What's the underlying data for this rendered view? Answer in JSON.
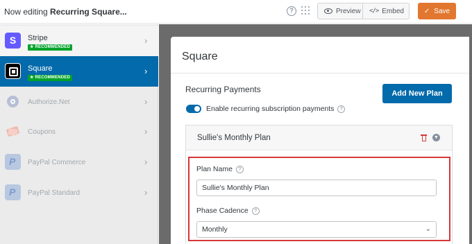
{
  "header": {
    "title_prefix": "Now editing ",
    "title_form": "Recurring Square...",
    "help_glyph": "?",
    "preview_label": "Preview",
    "embed_label": "Embed",
    "save_label": "Save"
  },
  "sidebar": {
    "items": [
      {
        "label": "Stripe",
        "badge": "RECOMMENDED",
        "icon": "stripe-icon"
      },
      {
        "label": "Square",
        "badge": "RECOMMENDED",
        "icon": "square-icon",
        "active": true
      },
      {
        "label": "Authorize.Net",
        "icon": "authorize-net-icon"
      },
      {
        "label": "Coupons",
        "icon": "coupons-icon"
      },
      {
        "label": "PayPal Commerce",
        "icon": "paypal-icon"
      },
      {
        "label": "PayPal Standard",
        "icon": "paypal-icon"
      }
    ],
    "stripe_glyph": "S",
    "paypal_glyph": "P"
  },
  "panel": {
    "title": "Square",
    "section_title": "Recurring Payments",
    "add_plan_label": "Add New Plan",
    "toggle_label": "Enable recurring subscription payments",
    "toggle_on": true
  },
  "plan": {
    "name": "Sullie's Monthly Plan",
    "plan_name_label": "Plan Name",
    "plan_name_value": "Sullie's Monthly Plan",
    "phase_cadence_label": "Phase Cadence",
    "phase_cadence_value": "Monthly"
  },
  "colors": {
    "accent": "#036aab",
    "save": "#e27730",
    "highlight": "#d63638",
    "badge": "#00a32a"
  }
}
